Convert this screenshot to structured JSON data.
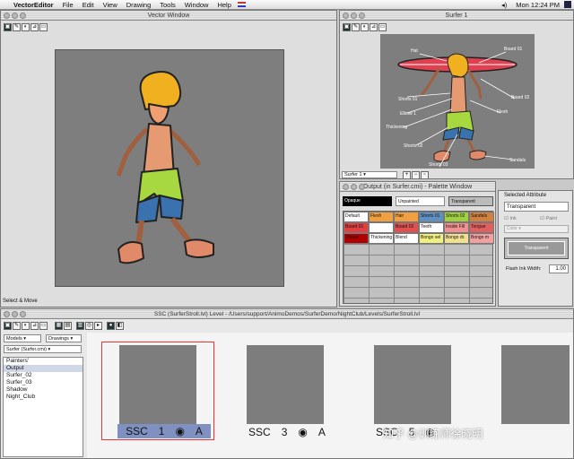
{
  "menubar": {
    "app": "VectorEditor",
    "items": [
      "File",
      "Edit",
      "View",
      "Drawing",
      "Tools",
      "Window",
      "Help"
    ],
    "clock": "Mon 12:24 PM"
  },
  "vector_window": {
    "title": "Vector Window",
    "status": "Select & Move"
  },
  "surfer_window": {
    "title": "Surfer 1",
    "select": "Surfer 1",
    "callouts": [
      "Hat",
      "Board 01",
      "Board 02",
      "Shorts 01",
      "Elbow 1",
      "Thickening",
      "Flesh",
      "Shorts 02",
      "Sandals",
      "Shorts 03"
    ]
  },
  "palette_window": {
    "title": "Output (in Surfer.cmi) - Palette Window",
    "tabs": [
      "Opaque",
      "Unpainted",
      "Transparent"
    ],
    "rows": [
      [
        "Default",
        "Flesh",
        "Hair",
        "Shorts 01",
        "Shorts 02",
        "Sandals"
      ],
      [
        "Board 01",
        "",
        "Board 02",
        "Teeth",
        "Inside Fill",
        "Tongue"
      ],
      [
        "Throat",
        "Thickening",
        "Blend",
        "Bongo sel",
        "Bongo dr.",
        "Bongo m"
      ]
    ],
    "row_colors": [
      [
        "#ffffff",
        "#f0a040",
        "#f0a040",
        "#6090c0",
        "#a0d040",
        "#d08040"
      ],
      [
        "#e04040",
        "#ffffff",
        "#e05050",
        "#ffffff",
        "#f09090",
        "#e06060"
      ],
      [
        "#b00000",
        "#ffffff",
        "#ffffff",
        "#f0f080",
        "#f0e090",
        "#f0a0a0"
      ]
    ]
  },
  "attribute_panel": {
    "title": "Selected Attribute",
    "value": "Transparent",
    "ink": "Ink",
    "paint": "Paint",
    "color": "Color",
    "swatch": "Transparent",
    "flash_label": "Flash Ink Width:",
    "flash_value": "1.00"
  },
  "level_window": {
    "title": "SSC (SurferStroll.lvl) Level - /Users/support/AnimoDemos/SurferDemo/NightClub/Levels/SurferStroll.lvl",
    "models": "Models",
    "drawings": "Drawings",
    "model": "Surfer (Surfer.cmi)",
    "layers": [
      "Painters'",
      "Output",
      "Surfer_02",
      "Surfer_03",
      "Shadow",
      "Night_Club"
    ],
    "selected_layer": "Output",
    "frames": [
      {
        "a": "SSC",
        "b": "1",
        "c": "A"
      },
      {
        "a": "SSC",
        "b": "3",
        "c": "A"
      },
      {
        "a": "SSC",
        "b": "5",
        "c": ""
      },
      {
        "a": "",
        "b": "",
        "c": ""
      }
    ]
  },
  "watermark": "知乎 @训练师徐晓明"
}
